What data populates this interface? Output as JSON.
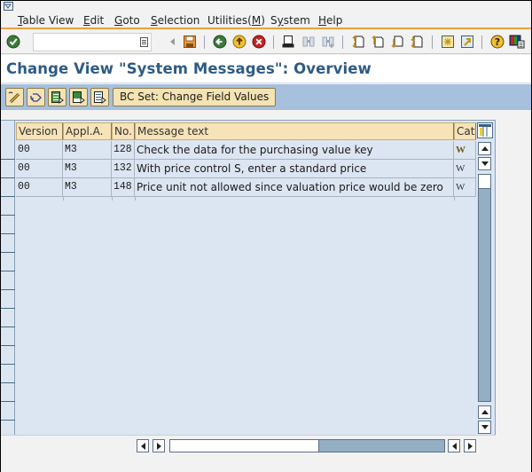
{
  "window": {
    "icon": "sap-window-icon"
  },
  "menubar": {
    "items": [
      {
        "label": "Table View",
        "mnemonic": "T"
      },
      {
        "label": "Edit",
        "mnemonic": "E"
      },
      {
        "label": "Goto",
        "mnemonic": "G"
      },
      {
        "label": "Selection",
        "mnemonic": "S"
      },
      {
        "label": "Utilities(M)",
        "mnemonic": "M"
      },
      {
        "label": "System",
        "mnemonic": "y"
      },
      {
        "label": "Help",
        "mnemonic": "H"
      }
    ]
  },
  "toolbar": {
    "command_field": {
      "value": "",
      "placeholder": ""
    },
    "icons": [
      "enter-icon",
      "history-icon",
      "back-nav-icon",
      "save-icon",
      "back-icon",
      "exit-icon",
      "cancel-icon",
      "print-icon",
      "find-icon",
      "find-next-icon",
      "first-page-icon",
      "previous-page-icon",
      "next-page-icon",
      "last-page-icon",
      "create-session-icon",
      "shortcut-icon",
      "help-icon",
      "customize-layout-icon"
    ]
  },
  "title": {
    "text": "Change View \"System Messages\": Overview"
  },
  "app_toolbar": {
    "icons": [
      "display-change-icon",
      "undo-change-icon",
      "select-all-icon",
      "select-block-icon",
      "deselect-all-icon"
    ],
    "bcset_label": "BC Set: Change Field Values"
  },
  "table": {
    "columns": [
      "Version",
      "Appl.A.",
      "No.",
      "Message text",
      "Cat"
    ],
    "rows": [
      {
        "version": "00",
        "appl_area": "M3",
        "no": "128",
        "message_text": "Check the data for the purchasing value key",
        "cat": "W"
      },
      {
        "version": "00",
        "appl_area": "M3",
        "no": "132",
        "message_text": "With price control S, enter a standard price",
        "cat": "W"
      },
      {
        "version": "00",
        "appl_area": "M3",
        "no": "148",
        "message_text": "Price unit not allowed since valuation price would be zero",
        "cat": "W"
      }
    ],
    "column_config_icon": "table-settings-icon"
  },
  "colors": {
    "title": "#2e5b84",
    "menu_accent": "#e8a33d",
    "app_toolbar_bg": "#a6c0dd",
    "header_bg": "#f6e3b7",
    "table_bg": "#dce6f2"
  }
}
